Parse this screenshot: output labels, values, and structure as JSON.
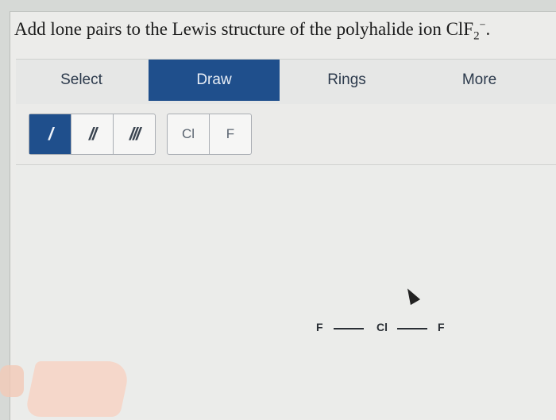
{
  "question": {
    "text": "Add lone pairs to the Lewis structure of the polyhalide ion ClF",
    "subscript": "2",
    "charge": "−",
    "period": "."
  },
  "toolbar": {
    "tabs": [
      {
        "label": "Select",
        "active": false
      },
      {
        "label": "Draw",
        "active": true
      },
      {
        "label": "Rings",
        "active": false
      },
      {
        "label": "More",
        "active": false
      }
    ]
  },
  "bond_tools": [
    "/",
    "//",
    "///"
  ],
  "atom_tools": [
    "Cl",
    "F"
  ],
  "structure": {
    "left_atom": "F",
    "center_atom": "Cl",
    "right_atom": "F"
  },
  "colors": {
    "accent": "#1f4f8c",
    "background": "#ececea"
  }
}
